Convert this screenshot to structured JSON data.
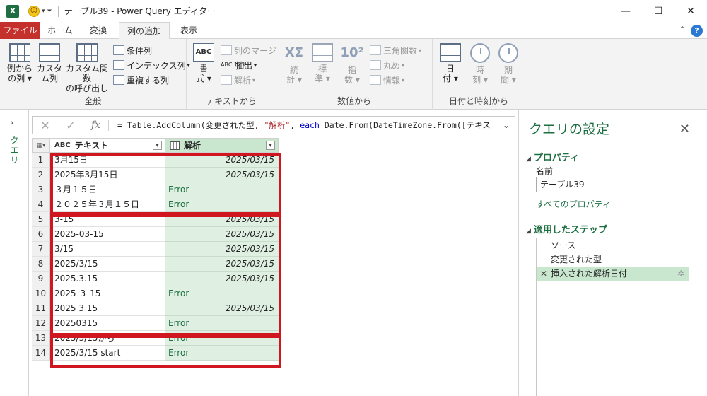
{
  "window": {
    "title": "テーブル39 - Power Query エディター",
    "app_icon": "X",
    "controls": [
      "—",
      "☐",
      "✕"
    ]
  },
  "tabs": [
    {
      "label": "ファイル"
    },
    {
      "label": "ホーム"
    },
    {
      "label": "変換"
    },
    {
      "label": "列の追加"
    },
    {
      "label": "表示"
    }
  ],
  "ribbon": {
    "general": {
      "label": "全般",
      "col_from_examples": [
        "例から",
        "の列 ▾"
      ],
      "custom_column": [
        "カスタ",
        "ム列"
      ],
      "invoke_custom_function": [
        "カスタム関数",
        "の呼び出し"
      ],
      "conditional_column": "条件列",
      "index_column": "インデックス列",
      "duplicate_column": "重複する列"
    },
    "text": {
      "label": "テキストから",
      "format": [
        "書",
        "式 ▾"
      ],
      "merge_columns": "列のマージ",
      "extract": "抽出",
      "parse": "解析",
      "abc_icon": "ABC",
      "abc123_icon": "ABC 123"
    },
    "number": {
      "label": "数値から",
      "statistics": [
        "統",
        "計 ▾"
      ],
      "standard": [
        "標",
        "準 ▾"
      ],
      "scientific": [
        "指",
        "数 ▾"
      ],
      "trigonometry": "三角関数",
      "rounding": "丸め",
      "information": "情報",
      "sigma_glyph": "XΣ",
      "power_glyph": "10²"
    },
    "datetime": {
      "label": "日付と時刻から",
      "date": [
        "日",
        "付 ▾"
      ],
      "time": [
        "時",
        "刻 ▾"
      ],
      "duration": [
        "期",
        "間 ▾"
      ]
    }
  },
  "left_pane": {
    "label": "クエリ"
  },
  "formula_bar": {
    "cancel": "✕",
    "commit": "✓",
    "fx": "fx",
    "formula_prefix": "= Table.AddColumn(変更された型, ",
    "formula_str": "\"解析\"",
    "formula_mid": ", ",
    "formula_kw": "each",
    "formula_rest": " Date.From(DateTimeZone.From([テキス"
  },
  "table": {
    "col1": {
      "type_icon": "ABC",
      "header": "テキスト"
    },
    "col2": {
      "header": "解析"
    },
    "rows": [
      {
        "n": "1",
        "text": "3月15日",
        "result": "2025/03/15",
        "ok": true
      },
      {
        "n": "2",
        "text": "2025年3月15日",
        "result": "2025/03/15",
        "ok": true
      },
      {
        "n": "3",
        "text": "３月１５日",
        "result": "Error",
        "ok": false
      },
      {
        "n": "4",
        "text": "２０２５年３月１５日",
        "result": "Error",
        "ok": false
      },
      {
        "n": "5",
        "text": "3-15",
        "result": "2025/03/15",
        "ok": true
      },
      {
        "n": "6",
        "text": "2025-03-15",
        "result": "2025/03/15",
        "ok": true
      },
      {
        "n": "7",
        "text": "3/15",
        "result": "2025/03/15",
        "ok": true
      },
      {
        "n": "8",
        "text": "2025/3/15",
        "result": "2025/03/15",
        "ok": true
      },
      {
        "n": "9",
        "text": "2025.3.15",
        "result": "2025/03/15",
        "ok": true
      },
      {
        "n": "10",
        "text": "2025_3_15",
        "result": "Error",
        "ok": false
      },
      {
        "n": "11",
        "text": "2025 3 15",
        "result": "2025/03/15",
        "ok": true
      },
      {
        "n": "12",
        "text": "20250315",
        "result": "Error",
        "ok": false
      },
      {
        "n": "13",
        "text": "2025/3/15から",
        "result": "Error",
        "ok": false
      },
      {
        "n": "14",
        "text": "2025/3/15 start",
        "result": "Error",
        "ok": false
      }
    ]
  },
  "settings": {
    "title": "クエリの設定",
    "properties_section": "プロパティ",
    "name_label": "名前",
    "name_value": "テーブル39",
    "all_properties": "すべてのプロパティ",
    "applied_steps_section": "適用したステップ",
    "steps": [
      "ソース",
      "変更された型",
      "挿入された解析日付"
    ]
  },
  "colors": {
    "accent": "#1d6f42",
    "file_tab": "#c4302b",
    "highlight": "#d0161e",
    "result_col": "#dff0e2"
  }
}
